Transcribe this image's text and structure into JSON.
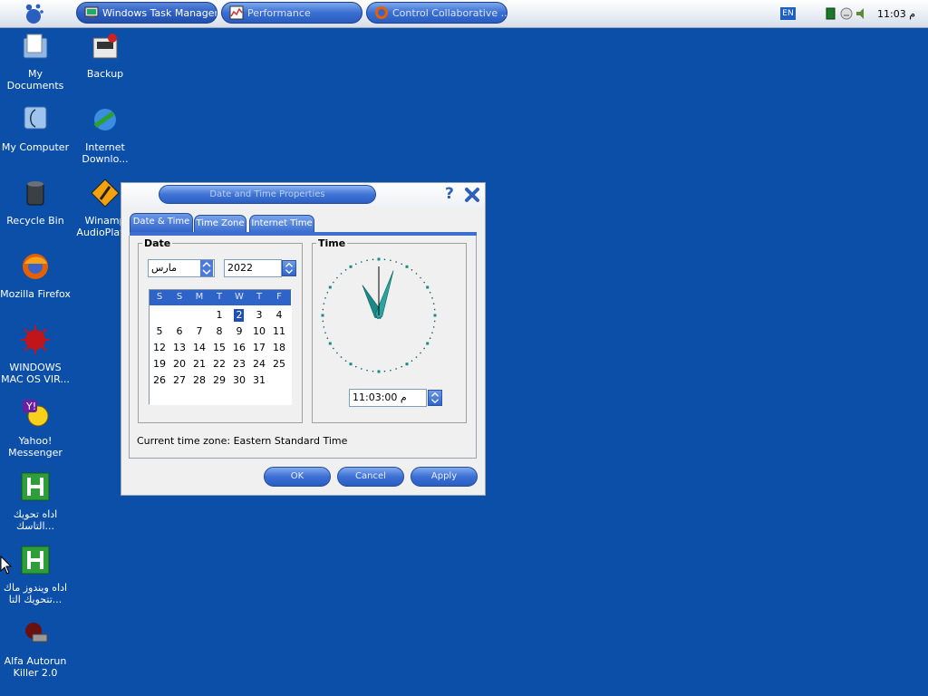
{
  "taskbar": {
    "tasks": [
      {
        "label": "Windows Task Manager",
        "icon": "task-manager-icon"
      },
      {
        "label": "Performance",
        "icon": "performance-icon"
      },
      {
        "label": "Control Collaborative ...",
        "icon": "firefox-icon"
      }
    ],
    "language": "EN",
    "clock": "م 11:03"
  },
  "desktop": {
    "icons": [
      {
        "label": "My Documents",
        "icon": "folder-documents-icon"
      },
      {
        "label": "Backup",
        "icon": "backup-icon"
      },
      {
        "label": "My Computer",
        "icon": "my-computer-icon"
      },
      {
        "label": "Internet Downlo...",
        "icon": "internet-download-manager-icon"
      },
      {
        "label": "Recycle Bin",
        "icon": "recycle-bin-icon"
      },
      {
        "label": "Winamp AudioPlay...",
        "icon": "winamp-icon"
      },
      {
        "label": "Mozilla Firefox",
        "icon": "firefox-icon"
      },
      {
        "label": "WINDOWS MAC OS VIR...",
        "icon": "virus-icon"
      },
      {
        "label": "Yahoo! Messenger",
        "icon": "yahoo-messenger-icon"
      },
      {
        "label": "اداه تحويك التاسك...",
        "icon": "h-app-icon"
      },
      {
        "label": "اداه ويندوز ماك تتحويك التا...",
        "icon": "h-app-icon"
      },
      {
        "label": "Alfa Autorun Killer 2.0",
        "icon": "autorun-killer-icon"
      }
    ]
  },
  "dialog": {
    "title": "Date and Time Properties",
    "tabs": [
      "Date & Time",
      "Time Zone",
      "Internet Time"
    ],
    "date_group": "Date",
    "time_group": "Time",
    "month": "مارس",
    "year": "2022",
    "weekdays": [
      "S",
      "S",
      "M",
      "T",
      "W",
      "T",
      "F"
    ],
    "calendar_rows": [
      [
        "",
        "",
        "",
        "1",
        "2",
        "3",
        "4"
      ],
      [
        "5",
        "6",
        "7",
        "8",
        "9",
        "10",
        "11"
      ],
      [
        "12",
        "13",
        "14",
        "15",
        "16",
        "17",
        "18"
      ],
      [
        "19",
        "20",
        "21",
        "22",
        "23",
        "24",
        "25"
      ],
      [
        "26",
        "27",
        "28",
        "29",
        "30",
        "31",
        ""
      ]
    ],
    "selected_day": "2",
    "time_value": "11:03:00 م",
    "current_tz_label": "Current time zone:  Eastern Standard Time",
    "buttons": {
      "ok": "OK",
      "cancel": "Cancel",
      "apply": "Apply"
    },
    "clock": {
      "hour": 11,
      "minute": 3,
      "second": 0
    }
  },
  "colors": {
    "desktop": "#0b4fa8",
    "accent": "#2e63c8"
  }
}
